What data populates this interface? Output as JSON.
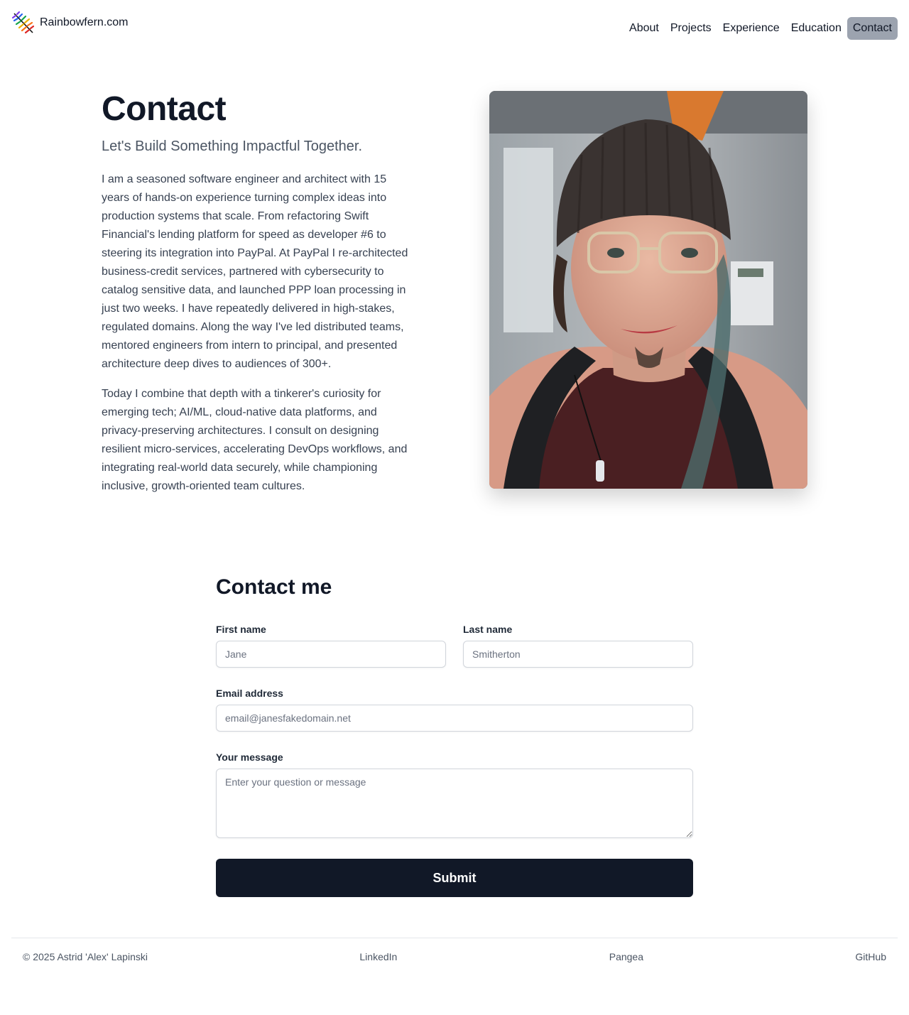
{
  "header": {
    "brand_name": "Rainbowfern.com",
    "logo_icon": "rainbow-fern-logo-icon",
    "nav": [
      {
        "label": "About",
        "active": false
      },
      {
        "label": "Projects",
        "active": false
      },
      {
        "label": "Experience",
        "active": false
      },
      {
        "label": "Education",
        "active": false
      },
      {
        "label": "Contact",
        "active": true
      }
    ]
  },
  "intro": {
    "title": "Contact",
    "subtitle": "Let's Build Something Impactful Together.",
    "paragraph1": "I am a seasoned software engineer and architect with 15 years of hands-on experience turning complex ideas into production systems that scale. From refactoring Swift Financial's lending platform for speed as developer #6 to steering its integration into PayPal. At PayPal I re-architected business-credit services, partnered with cybersecurity to catalog sensitive data, and launched PPP loan processing in just two weeks. I have repeatedly delivered in high-stakes, regulated domains. Along the way I've led distributed teams, mentored engineers from intern to principal, and presented architecture deep dives to audiences of 300+.",
    "paragraph2": "Today I combine that depth with a tinkerer's curiosity for emerging tech; AI/ML, cloud-native data platforms, and privacy-preserving architectures. I consult on designing resilient micro-services, accelerating DevOps workflows, and integrating real-world data securely, while championing inclusive, growth-oriented team cultures."
  },
  "form": {
    "title": "Contact me",
    "first_name_label": "First name",
    "first_name_placeholder": "Jane",
    "first_name_value": "",
    "last_name_label": "Last name",
    "last_name_placeholder": "Smitherton",
    "last_name_value": "",
    "email_label": "Email address",
    "email_placeholder": "email@janesfakedomain.net",
    "email_value": "",
    "message_label": "Your message",
    "message_placeholder": "Enter your question or message",
    "message_value": "",
    "submit_label": "Submit"
  },
  "footer": {
    "copyright": "© 2025 Astrid 'Alex' Lapinski",
    "links": [
      "LinkedIn",
      "Pangea",
      "GitHub"
    ]
  },
  "colors": {
    "primary_dark": "#111827",
    "nav_active_bg": "#9ca3af",
    "text_muted": "#4b5563"
  }
}
